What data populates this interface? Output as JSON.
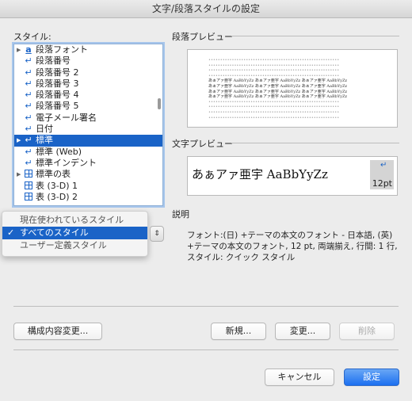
{
  "window": {
    "title": "文字/段落スタイルの設定"
  },
  "styles": {
    "label": "スタイル:",
    "items": [
      {
        "label": "段落フォント",
        "icon": "a-underline",
        "disclosure": true
      },
      {
        "label": "段落番号",
        "icon": "return"
      },
      {
        "label": "段落番号 2",
        "icon": "return"
      },
      {
        "label": "段落番号 3",
        "icon": "return"
      },
      {
        "label": "段落番号 4",
        "icon": "return"
      },
      {
        "label": "段落番号 5",
        "icon": "return"
      },
      {
        "label": "電子メール署名",
        "icon": "return"
      },
      {
        "label": "日付",
        "icon": "return"
      },
      {
        "label": "標準",
        "icon": "return",
        "selected": true,
        "disclosure": true
      },
      {
        "label": "標準 (Web)",
        "icon": "return"
      },
      {
        "label": "標準インデント",
        "icon": "return"
      },
      {
        "label": "標準の表",
        "icon": "table",
        "disclosure": true
      },
      {
        "label": "表 (3-D) 1",
        "icon": "table"
      },
      {
        "label": "表 (3-D) 2",
        "icon": "table"
      }
    ]
  },
  "filter_menu": {
    "options": [
      "現在使われているスタイル",
      "すべてのスタイル",
      "ユーザー定義スタイル"
    ],
    "selected": "すべてのスタイル",
    "check": "✓"
  },
  "paragraph_preview": {
    "label": "段落プレビュー",
    "sample_text": "あぁアァ亜宇 AaBbYyZz"
  },
  "character_preview": {
    "label": "文字プレビュー",
    "sample": "あぁアァ亜宇 AaBbYyZz",
    "size": "12pt"
  },
  "description": {
    "label": "説明",
    "text_lines": [
      "フォント:(日) +テーマの本文のフォント - 日本語, (英)",
      "+テーマの本文のフォント, 12 pt, 両端揃え, 行間: 1 行,",
      "スタイル: クイック スタイル"
    ]
  },
  "buttons": {
    "organizer": "構成内容変更...",
    "new": "新規...",
    "modify": "変更...",
    "delete": "削除",
    "cancel": "キャンセル",
    "apply": "設定"
  },
  "colors": {
    "selection": "#1a63c7",
    "primary_button": "#1c6ff0"
  }
}
